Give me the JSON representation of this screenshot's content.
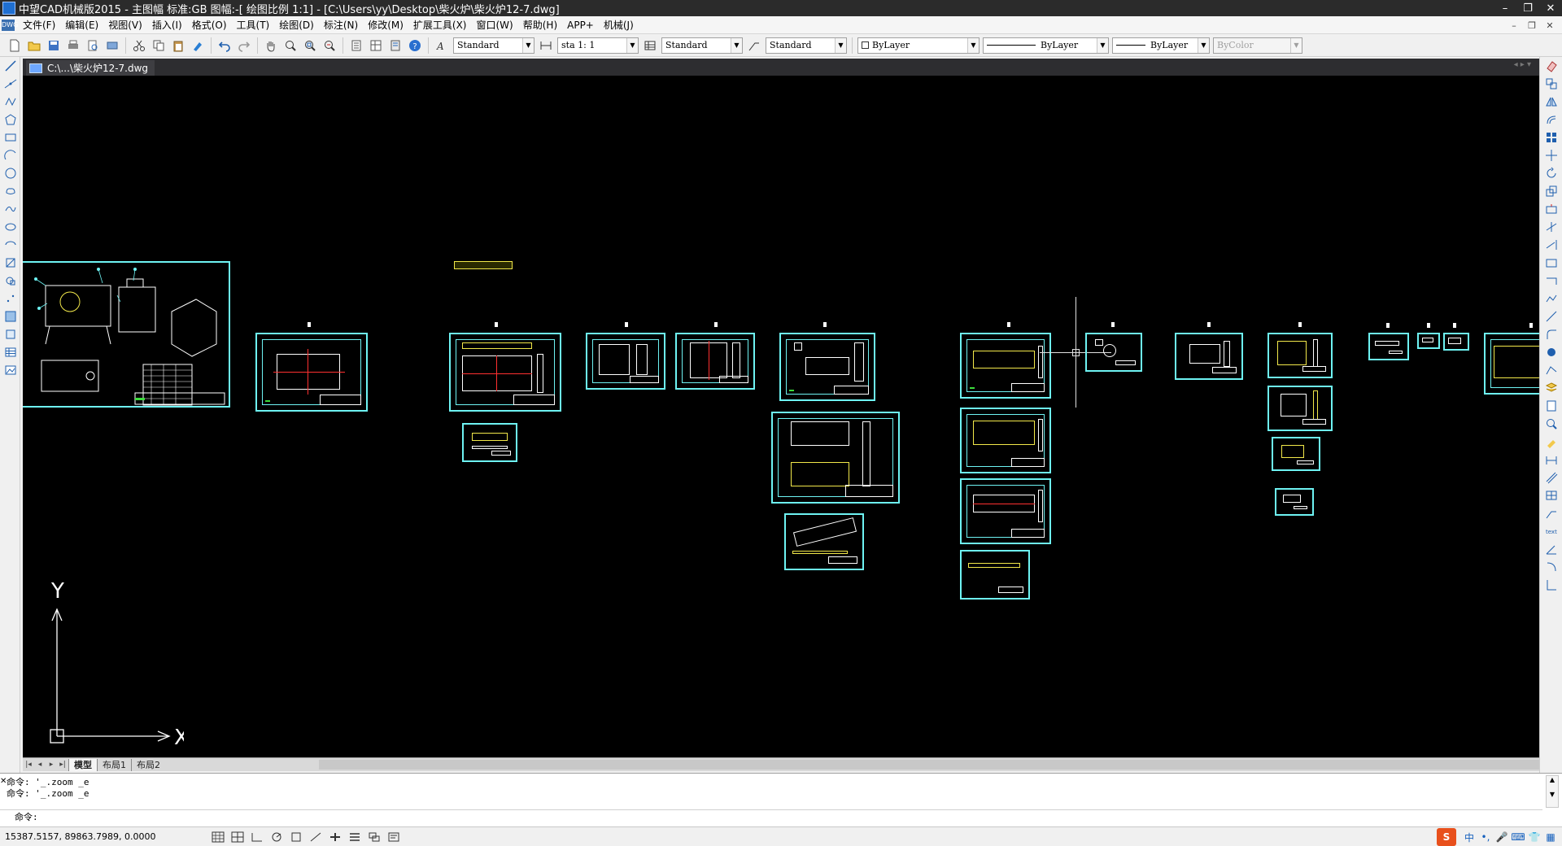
{
  "window": {
    "title": "中望CAD机械版2015 - 主图幅  标准:GB 图幅:-[ 绘图比例 1:1] - [C:\\Users\\yy\\Desktop\\柴火炉\\柴火炉12-7.dwg]",
    "min": "–",
    "max": "❐",
    "close": "✕"
  },
  "menu": {
    "items": [
      "文件(F)",
      "编辑(E)",
      "视图(V)",
      "插入(I)",
      "格式(O)",
      "工具(T)",
      "绘图(D)",
      "标注(N)",
      "修改(M)",
      "扩展工具(X)",
      "窗口(W)",
      "帮助(H)",
      "APP+",
      "机械(J)"
    ]
  },
  "toolbar": {
    "text_style": "Standard",
    "scale": "sta 1: 1",
    "table_style": "Standard",
    "multileader_style": "Standard",
    "layer": "ByLayer",
    "linetype": "ByLayer",
    "lineweight": "ByLayer",
    "color": "ByColor"
  },
  "document": {
    "tab_label": "C:\\...\\柴火炉12-7.dwg",
    "nav": "◂ ▸ ▾"
  },
  "ucs": {
    "x_label": "X",
    "y_label": "Y"
  },
  "layout_tabs": {
    "model": "模型",
    "layout1": "布局1",
    "layout2": "布局2"
  },
  "command": {
    "history": [
      "命令: '_.zoom _e",
      "命令: '_.zoom _e"
    ],
    "prompt": "命令:"
  },
  "status": {
    "coords": "15387.5157,  89863.7989,  0.0000"
  },
  "tray": {
    "ime_logo": "S",
    "ime_mode": "中"
  },
  "colors": {
    "sheet_frame": "#6ef3f3",
    "centerline": "#ff3030",
    "object": "#ffffff",
    "hidden": "#f2e84a",
    "canvas": "#000000"
  }
}
